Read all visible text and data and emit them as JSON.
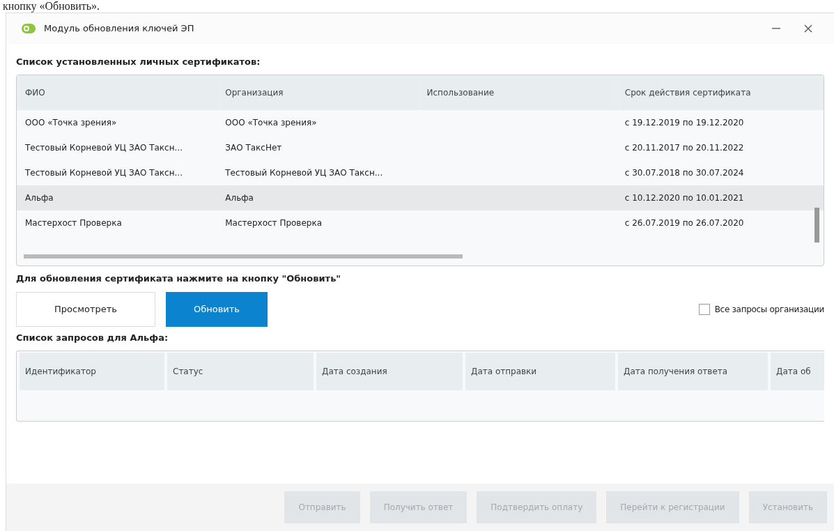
{
  "document_text": "кнопку «Обновить».",
  "window": {
    "title": "Модуль обновления ключей ЭП"
  },
  "certificates": {
    "heading": "Список установленных личных сертификатов:",
    "columns": [
      "ФИО",
      "Организация",
      "Использование",
      "Срок действия сертификата"
    ],
    "rows": [
      {
        "cells": [
          "ООО «Точка зрения»",
          "ООО «Точка зрения»",
          "",
          "с 19.12.2019 по 19.12.2020"
        ],
        "selected": false
      },
      {
        "cells": [
          "Тестовый Корневой УЦ ЗАО Таксн...",
          "ЗАО ТаксНет",
          "",
          "с 20.11.2017 по 20.11.2022"
        ],
        "selected": false
      },
      {
        "cells": [
          "Тестовый Корневой УЦ ЗАО Таксн...",
          "Тестовый Корневой УЦ ЗАО Таксн...",
          "",
          "с 30.07.2018 по 30.07.2024"
        ],
        "selected": false
      },
      {
        "cells": [
          "Альфа",
          "Альфа",
          "",
          "с 10.12.2020 по 10.01.2021"
        ],
        "selected": true
      },
      {
        "cells": [
          "Мастерхост Проверка",
          "Мастерхост Проверка",
          "",
          "с 26.07.2019 по 26.07.2020"
        ],
        "selected": false
      }
    ]
  },
  "hint": "Для обновления сертификата нажмите на кнопку \"Обновить\"",
  "actions": [
    {
      "label": "Просмотреть",
      "kind": "secondary"
    },
    {
      "label": "Обновить",
      "kind": "primary"
    }
  ],
  "all_requests_checkbox": {
    "label": "Все запросы организации",
    "checked": false
  },
  "requests": {
    "heading": "Список запросов для Альфа:",
    "columns": [
      "Идентификатор",
      "Статус",
      "Дата создания",
      "Дата отправки",
      "Дата получения ответа",
      "Дата об"
    ]
  },
  "footer_buttons": [
    {
      "label": "Отправить",
      "disabled": true
    },
    {
      "label": "Получить ответ",
      "disabled": true
    },
    {
      "label": "Подтвердить оплату",
      "disabled": true
    },
    {
      "label": "Перейти к регистрации",
      "disabled": true
    },
    {
      "label": "Установить",
      "disabled": true
    }
  ]
}
